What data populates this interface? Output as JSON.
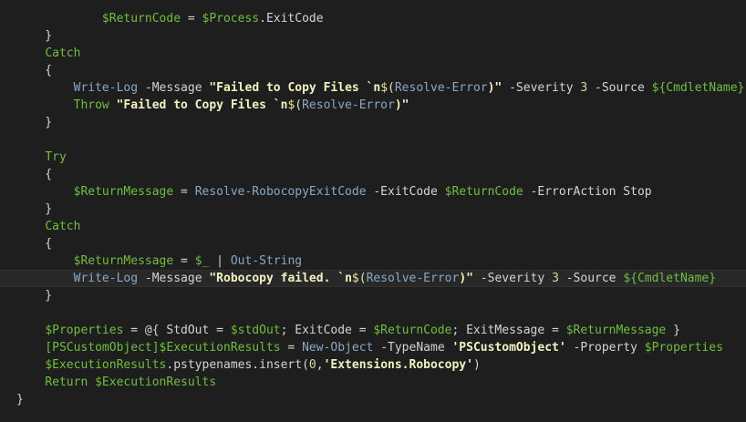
{
  "editor": {
    "highlighted_line": 15,
    "lines": [
      [
        {
          "t": "            ",
          "c": "ident"
        },
        {
          "t": "$ReturnCode",
          "c": "var"
        },
        {
          "t": " = ",
          "c": "punct"
        },
        {
          "t": "$Process",
          "c": "var"
        },
        {
          "t": ".ExitCode",
          "c": "ident"
        }
      ],
      [
        {
          "t": "    }",
          "c": "punct"
        }
      ],
      [
        {
          "t": "    ",
          "c": "ident"
        },
        {
          "t": "Catch",
          "c": "kw"
        }
      ],
      [
        {
          "t": "    {",
          "c": "punct"
        }
      ],
      [
        {
          "t": "        ",
          "c": "ident"
        },
        {
          "t": "Write-Log",
          "c": "cmd"
        },
        {
          "t": " -Message ",
          "c": "param"
        },
        {
          "t": "\"Failed to Copy Files `n",
          "c": "strb"
        },
        {
          "t": "$(",
          "c": "str"
        },
        {
          "t": "Resolve-Error",
          "c": "cmd"
        },
        {
          "t": ")\"",
          "c": "strb"
        },
        {
          "t": " -Severity ",
          "c": "param"
        },
        {
          "t": "3",
          "c": "num"
        },
        {
          "t": " -Source ",
          "c": "param"
        },
        {
          "t": "${CmdletName}",
          "c": "var"
        }
      ],
      [
        {
          "t": "        ",
          "c": "ident"
        },
        {
          "t": "Throw",
          "c": "kw"
        },
        {
          "t": " ",
          "c": "ident"
        },
        {
          "t": "\"Failed to Copy Files `n",
          "c": "strb"
        },
        {
          "t": "$(",
          "c": "str"
        },
        {
          "t": "Resolve-Error",
          "c": "cmd"
        },
        {
          "t": ")\"",
          "c": "strb"
        }
      ],
      [
        {
          "t": "    }",
          "c": "punct"
        }
      ],
      [
        {
          "t": "",
          "c": "ident"
        }
      ],
      [
        {
          "t": "    ",
          "c": "ident"
        },
        {
          "t": "Try",
          "c": "kw"
        }
      ],
      [
        {
          "t": "    {",
          "c": "punct"
        }
      ],
      [
        {
          "t": "        ",
          "c": "ident"
        },
        {
          "t": "$ReturnMessage",
          "c": "var"
        },
        {
          "t": " = ",
          "c": "punct"
        },
        {
          "t": "Resolve-RobocopyExitCode",
          "c": "cmd"
        },
        {
          "t": " -ExitCode ",
          "c": "param"
        },
        {
          "t": "$ReturnCode",
          "c": "var"
        },
        {
          "t": " -ErrorAction Stop",
          "c": "param"
        }
      ],
      [
        {
          "t": "    }",
          "c": "punct"
        }
      ],
      [
        {
          "t": "    ",
          "c": "ident"
        },
        {
          "t": "Catch",
          "c": "kw"
        }
      ],
      [
        {
          "t": "    {",
          "c": "punct"
        }
      ],
      [
        {
          "t": "        ",
          "c": "ident"
        },
        {
          "t": "$ReturnMessage",
          "c": "var"
        },
        {
          "t": " = ",
          "c": "punct"
        },
        {
          "t": "$_",
          "c": "var"
        },
        {
          "t": " | ",
          "c": "punct"
        },
        {
          "t": "Out-String",
          "c": "cmd"
        }
      ],
      [
        {
          "t": "        ",
          "c": "ident"
        },
        {
          "t": "Write-Log",
          "c": "cmd"
        },
        {
          "t": " -Message ",
          "c": "param"
        },
        {
          "t": "\"Robocopy failed. `n",
          "c": "strb"
        },
        {
          "t": "$(",
          "c": "str"
        },
        {
          "t": "Resolve-Error",
          "c": "cmd"
        },
        {
          "t": ")\"",
          "c": "strb"
        },
        {
          "t": " -Severity ",
          "c": "param"
        },
        {
          "t": "3",
          "c": "num"
        },
        {
          "t": " -Source ",
          "c": "param"
        },
        {
          "t": "${CmdletName}",
          "c": "var"
        }
      ],
      [
        {
          "t": "    }",
          "c": "punct"
        }
      ],
      [
        {
          "t": "",
          "c": "ident"
        }
      ],
      [
        {
          "t": "    ",
          "c": "ident"
        },
        {
          "t": "$Properties",
          "c": "var"
        },
        {
          "t": " = @{ StdOut = ",
          "c": "punct"
        },
        {
          "t": "$stdOut",
          "c": "var"
        },
        {
          "t": "; ExitCode = ",
          "c": "punct"
        },
        {
          "t": "$ReturnCode",
          "c": "var"
        },
        {
          "t": "; ExitMessage = ",
          "c": "punct"
        },
        {
          "t": "$ReturnMessage",
          "c": "var"
        },
        {
          "t": " }",
          "c": "punct"
        }
      ],
      [
        {
          "t": "    ",
          "c": "ident"
        },
        {
          "t": "[PSCustomObject]",
          "c": "type"
        },
        {
          "t": "$ExecutionResults",
          "c": "var"
        },
        {
          "t": " = ",
          "c": "punct"
        },
        {
          "t": "New-Object",
          "c": "cmd"
        },
        {
          "t": " -TypeName ",
          "c": "param"
        },
        {
          "t": "'PSCustomObject'",
          "c": "strb"
        },
        {
          "t": " -Property ",
          "c": "param"
        },
        {
          "t": "$Properties",
          "c": "var"
        }
      ],
      [
        {
          "t": "    ",
          "c": "ident"
        },
        {
          "t": "$ExecutionResults",
          "c": "var"
        },
        {
          "t": ".pstypenames.insert(",
          "c": "method"
        },
        {
          "t": "0",
          "c": "num"
        },
        {
          "t": ",",
          "c": "punct"
        },
        {
          "t": "'Extensions.Robocopy'",
          "c": "strb"
        },
        {
          "t": ")",
          "c": "punct"
        }
      ],
      [
        {
          "t": "    ",
          "c": "ident"
        },
        {
          "t": "Return",
          "c": "kw"
        },
        {
          "t": " ",
          "c": "ident"
        },
        {
          "t": "$ExecutionResults",
          "c": "var"
        }
      ],
      [
        {
          "t": "}",
          "c": "punct"
        }
      ]
    ]
  }
}
